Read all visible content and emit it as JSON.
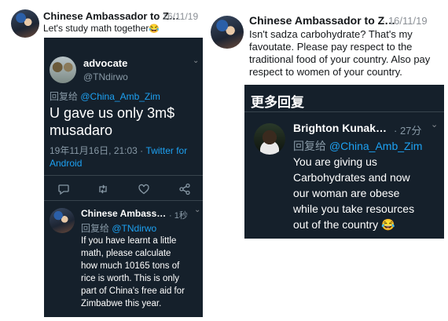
{
  "left_post": {
    "author": "Chinese Ambassador to Z…",
    "date": "· 16/11/19",
    "text": "Let's study math together",
    "emoji": "😂"
  },
  "quoted_tweet": {
    "name": "advocate",
    "handle": "@TNdirwo",
    "reply_prefix": "回复给",
    "reply_handle": "@China_Amb_Zim",
    "text_line1": "U gave us only 3m$",
    "text_line2": "musadaro",
    "timestamp": "19年11月16日, 21:03 ·",
    "source_part1": "Twitter for",
    "source_part2": "Android"
  },
  "ambassador_reply": {
    "name": "Chinese Ambass…",
    "time": "· 1秒",
    "reply_prefix": "回复给",
    "reply_handle": "@TNdirwo",
    "lines": [
      "If you have learnt a little",
      "math, please calculate",
      "how much 10165 tons of",
      "rice is worth. This is only",
      "part of China's free aid for",
      "Zimbabwe this year."
    ]
  },
  "right_post": {
    "author": "Chinese Ambassador to Z…",
    "date": "· 16/11/19",
    "lines": [
      "Isn't sadza carbohydrate? That's my",
      "favoutate. Please pay respect to the",
      "traditional food of your country. Also pay",
      "respect to women of your country."
    ]
  },
  "more_replies": {
    "header": "更多回复",
    "name": "Brighton Kunak…",
    "time": "· 27分",
    "reply_prefix": "回复给",
    "reply_handle": "@China_Amb_Zim",
    "lines": [
      "You are giving us",
      "Carbohydrates and now",
      "our woman are obese",
      "while you take resources",
      "out of the country"
    ],
    "emoji": "😂"
  },
  "icons": [
    "reply-icon",
    "retweet-icon",
    "like-icon",
    "share-icon",
    "chevron-down-icon"
  ],
  "colors": {
    "dark_bg": "#15202b",
    "link": "#1da1f2",
    "muted": "#8899a6"
  }
}
